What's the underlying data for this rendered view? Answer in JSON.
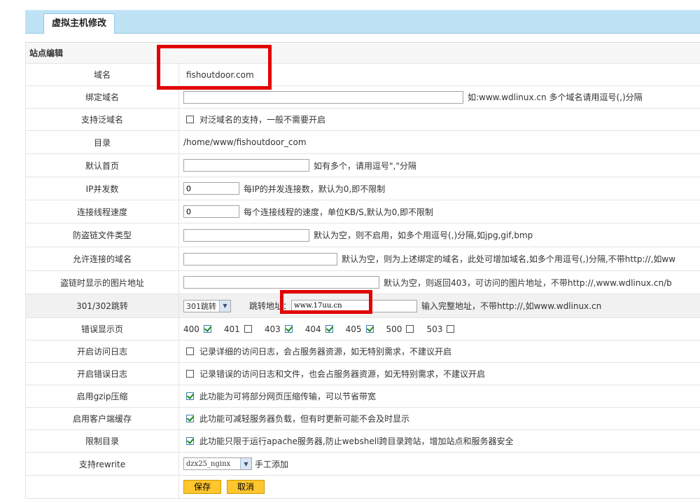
{
  "tab_title": "虚拟主机修改",
  "section_title": "站点编辑",
  "fields": {
    "domain": {
      "label": "域名",
      "value": "fishoutdoor.com"
    },
    "bind_domain": {
      "label": "绑定域名",
      "value": "",
      "hint": "如:www.wdlinux.cn 多个域名请用逗号(,)分隔"
    },
    "wildcard": {
      "label": "支持泛域名",
      "text": "对泛域名的支持，一般不需要开启"
    },
    "dir": {
      "label": "目录",
      "value": "/home/www/fishoutdoor_com"
    },
    "index": {
      "label": "默认首页",
      "value": "",
      "hint": "如有多个，请用逗号\",\"分隔"
    },
    "ip_conn": {
      "label": "IP并发数",
      "value": "0",
      "hint": "每IP的并发连接数，默认为0,即不限制"
    },
    "conn_speed": {
      "label": "连接线程速度",
      "value": "0",
      "hint": "每个连接线程的速度，单位KB/S,默认为0,即不限制"
    },
    "hotlink_types": {
      "label": "防盗链文件类型",
      "value": "",
      "hint": "默认为空，则不启用，如多个用逗号(,)分隔,如jpg,gif,bmp"
    },
    "allowed_domains": {
      "label": "允许连接的域名",
      "value": "",
      "hint": "默认为空，则为上述绑定的域名，此处可增加域名,如多个用逗号(,)分隔,不带http://,如ww"
    },
    "hotlink_image": {
      "label": "盗链时显示的图片地址",
      "value": "",
      "hint": "默认为空，则返回403，可访问的图片地址，不带http://,www.wdlinux.cn/b"
    },
    "redirect": {
      "label": "301/302跳转",
      "select": "301跳转",
      "addr_label": "跳转地址：",
      "addr_value": "www.17uu.cn",
      "hint": "输入完整地址，不带http://,如www.wdlinux.cn"
    },
    "error_pages": {
      "label": "错误显示页",
      "codes": [
        "400",
        "401",
        "403",
        "404",
        "405",
        "500",
        "503"
      ],
      "checked": [
        true,
        false,
        true,
        true,
        true,
        false,
        false
      ]
    },
    "access_log": {
      "label": "开启访问日志",
      "text": "记录详细的访问日志，会占服务器资源，如无特别需求，不建议开启"
    },
    "error_log": {
      "label": "开启错误日志",
      "text": "记录错误的访问日志和文件，也会占服务器资源，如无特别需求，不建议开启"
    },
    "gzip": {
      "label": "启用gzip压缩",
      "text": "此功能为可将部分网页压缩传输，可以节省带宽"
    },
    "client_cache": {
      "label": "启用客户端缓存",
      "text": "此功能可减轻服务器负载，但有时更新可能不会及时显示"
    },
    "limit_dir": {
      "label": "限制目录",
      "text": "此功能只限于运行apache服务器,防止webshell跨目录跨站，增加站点和服务器安全"
    },
    "rewrite": {
      "label": "支持rewrite",
      "select": "dzx25_nginx",
      "text": "手工添加"
    }
  },
  "buttons": {
    "save": "保存",
    "cancel": "取消"
  }
}
